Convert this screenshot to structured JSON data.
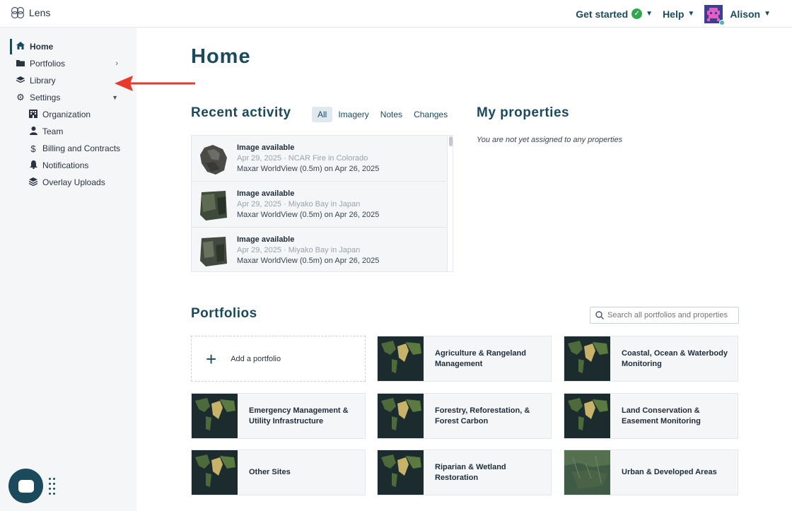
{
  "app": {
    "name": "Lens"
  },
  "header": {
    "get_started": "Get started",
    "help": "Help",
    "user_name": "Alison"
  },
  "sidebar": {
    "items": [
      {
        "label": "Home",
        "icon": "home-icon"
      },
      {
        "label": "Portfolios",
        "icon": "folder-icon"
      },
      {
        "label": "Library",
        "icon": "stack-icon"
      },
      {
        "label": "Settings",
        "icon": "gear-icon"
      },
      {
        "label": "Organization",
        "icon": "building-icon"
      },
      {
        "label": "Team",
        "icon": "person-icon"
      },
      {
        "label": "Billing and Contracts",
        "icon": "dollar-icon"
      },
      {
        "label": "Notifications",
        "icon": "bell-icon"
      },
      {
        "label": "Overlay Uploads",
        "icon": "layers-upload-icon"
      }
    ]
  },
  "main": {
    "title": "Home",
    "recent_activity": {
      "title": "Recent activity",
      "filters": [
        "All",
        "Imagery",
        "Notes",
        "Changes"
      ],
      "active_filter": "All",
      "items": [
        {
          "title": "Image available",
          "subtitle": "Apr 29, 2025 · NCAR Fire in Colorado",
          "detail": "Maxar WorldView (0.5m) on Apr 26, 2025"
        },
        {
          "title": "Image available",
          "subtitle": "Apr 29, 2025 · Miyako Bay in Japan",
          "detail": "Maxar WorldView (0.5m) on Apr 26, 2025"
        },
        {
          "title": "Image available",
          "subtitle": "Apr 29, 2025 · Miyako Bay in Japan",
          "detail": "Maxar WorldView (0.5m) on Apr 26, 2025"
        }
      ]
    },
    "my_properties": {
      "title": "My properties",
      "empty_message": "You are not yet assigned to any properties"
    },
    "portfolios": {
      "title": "Portfolios",
      "search_placeholder": "Search all portfolios and properties",
      "add_label": "Add a portfolio",
      "cards": [
        {
          "label": "Agriculture & Rangeland Management"
        },
        {
          "label": "Coastal, Ocean & Waterbody Monitoring"
        },
        {
          "label": "Emergency Management & Utility Infrastructure"
        },
        {
          "label": "Forestry, Reforestation, & Forest Carbon"
        },
        {
          "label": "Land Conservation & Easement Monitoring"
        },
        {
          "label": "Other Sites"
        },
        {
          "label": "Riparian & Wetland Restoration"
        },
        {
          "label": "Urban & Developed Areas"
        }
      ]
    }
  },
  "colors": {
    "brand": "#1a4a5c",
    "arrow": "#e8392a",
    "sidebar_bg": "#f4f6f8"
  }
}
